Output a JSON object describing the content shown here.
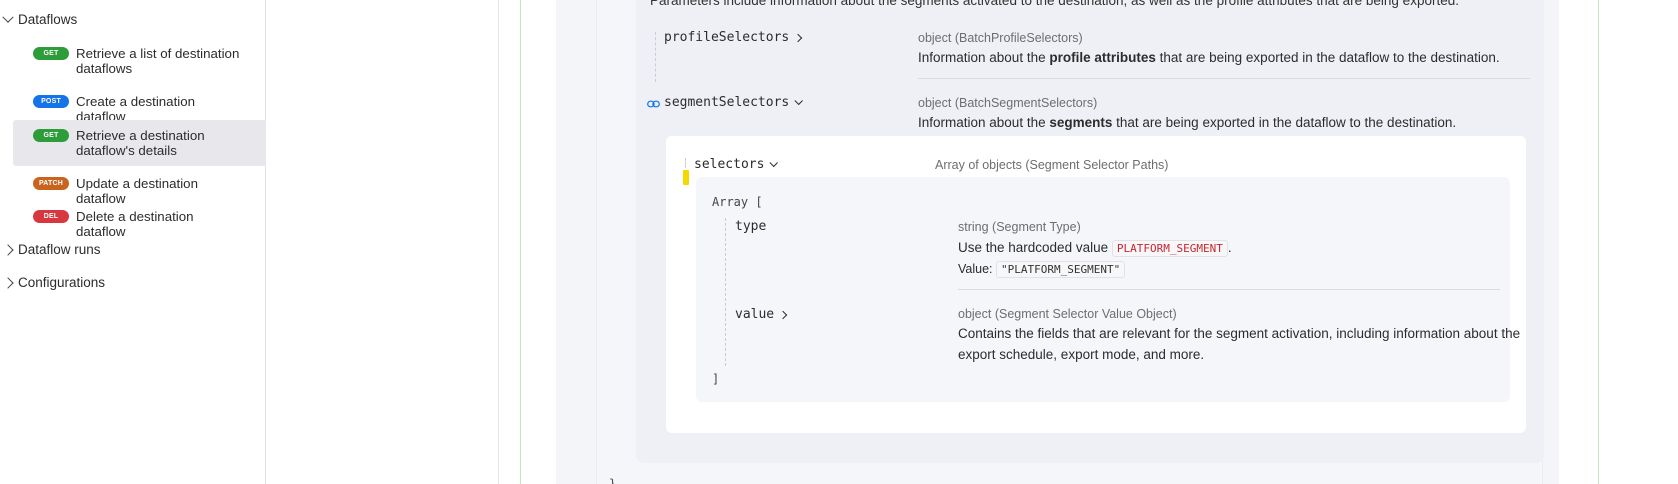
{
  "sidebar": {
    "groups": [
      {
        "label": "Dataflows",
        "expanded": true
      },
      {
        "label": "Dataflow runs",
        "expanded": false
      },
      {
        "label": "Configurations",
        "expanded": false
      }
    ],
    "items": [
      {
        "method": "GET",
        "label": "Retrieve a list of destination dataflows",
        "color": "#2d9d39"
      },
      {
        "method": "POST",
        "label": "Create a destination dataflow",
        "color": "#1473e6"
      },
      {
        "method": "GET",
        "label": "Retrieve a destination dataflow's details",
        "color": "#2d9d39",
        "active": true
      },
      {
        "method": "PATCH",
        "label": "Update a destination dataflow",
        "color": "#c8641e"
      },
      {
        "method": "DEL",
        "label": "Delete a destination dataflow",
        "color": "#d7373f"
      }
    ]
  },
  "content": {
    "intro": "Parameters include information about the segments activated to the destination, as well as the profile attributes that are being exported.",
    "profileSelectors": {
      "name": "profileSelectors",
      "type": "object (BatchProfileSelectors)",
      "desc_pre": "Information about the ",
      "desc_bold": "profile attributes",
      "desc_post": " that are being exported in the dataflow to the destination."
    },
    "segmentSelectors": {
      "name": "segmentSelectors",
      "type": "object (BatchSegmentSelectors)",
      "desc_pre": "Information about the ",
      "desc_bold": "segments",
      "desc_post": " that are being exported in the dataflow to the destination."
    },
    "selectors": {
      "name": "selectors",
      "type": "Array of objects (Segment Selector Paths)",
      "array_open": "Array [",
      "array_close": "]",
      "type_field": {
        "name": "type",
        "type": "string (Segment Type)",
        "desc_pre": "Use the hardcoded value",
        "code": "PLATFORM_SEGMENT",
        "desc_post": ".",
        "value_label": "Value:",
        "value": "\"PLATFORM_SEGMENT\""
      },
      "value_field": {
        "name": "value",
        "type": "object (Segment Selector Value Object)",
        "desc_line1": "Contains the fields that are relevant for the segment activation, including information about the",
        "desc_line2": "export schedule, export mode, and more."
      }
    },
    "bottom_char": "}"
  }
}
